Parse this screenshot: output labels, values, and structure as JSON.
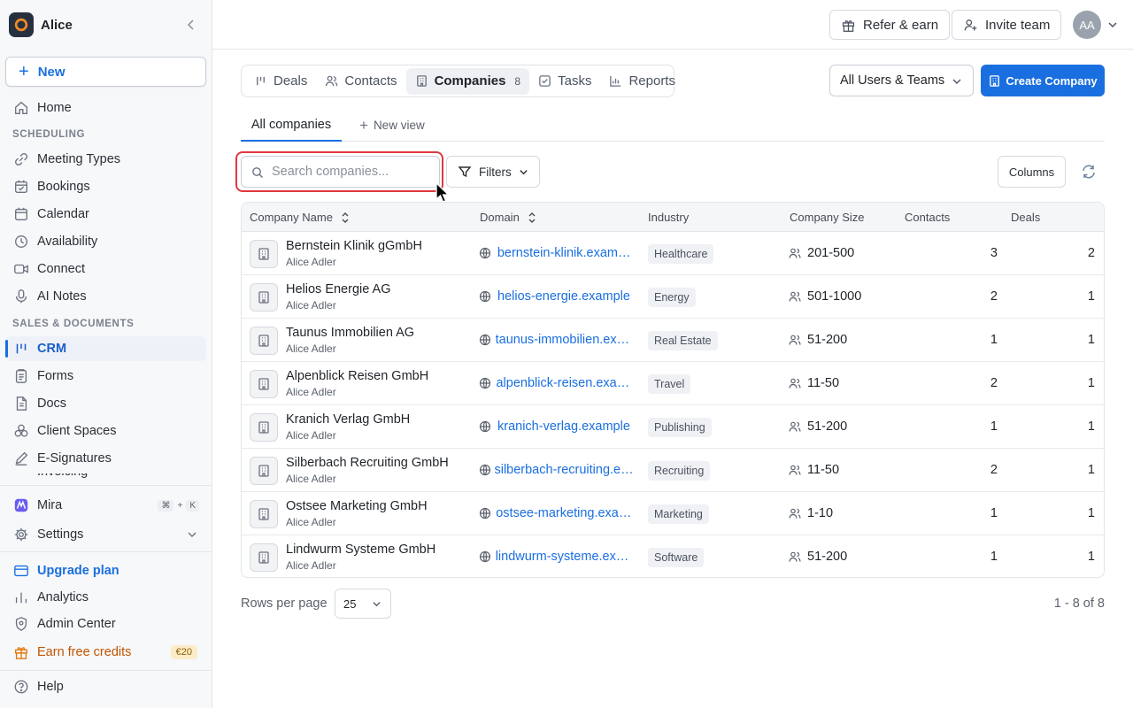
{
  "workspace": {
    "name": "Alice"
  },
  "sidebar": {
    "new_label": "New",
    "home": "Home",
    "section_scheduling": "SCHEDULING",
    "scheduling_items": [
      {
        "label": "Meeting Types",
        "icon": "link-icon"
      },
      {
        "label": "Bookings",
        "icon": "calendar-check-icon"
      },
      {
        "label": "Calendar",
        "icon": "calendar-icon"
      },
      {
        "label": "Availability",
        "icon": "clock-icon"
      },
      {
        "label": "Connect",
        "icon": "video-icon"
      },
      {
        "label": "AI Notes",
        "icon": "microphone-icon"
      }
    ],
    "section_sales": "SALES & DOCUMENTS",
    "sales_items": [
      {
        "label": "CRM",
        "icon": "crm-icon",
        "active": true
      },
      {
        "label": "Forms",
        "icon": "clipboard-icon"
      },
      {
        "label": "Docs",
        "icon": "document-icon"
      },
      {
        "label": "Client Spaces",
        "icon": "spaces-icon"
      },
      {
        "label": "E-Signatures",
        "icon": "pen-icon"
      },
      {
        "label": "Invoicing",
        "icon": "invoice-icon"
      }
    ],
    "mira": "Mira",
    "mira_shortcut": [
      "⌘",
      "+",
      "K"
    ],
    "settings": "Settings",
    "upgrade": "Upgrade plan",
    "analytics": "Analytics",
    "admin": "Admin Center",
    "earn": "Earn free credits",
    "earn_badge": "€20",
    "help": "Help"
  },
  "topbar": {
    "refer": "Refer & earn",
    "invite": "Invite team",
    "avatar_initials": "AA"
  },
  "crm_tabs": [
    {
      "label": "Deals",
      "icon": "deals-icon"
    },
    {
      "label": "Contacts",
      "icon": "contacts-icon"
    },
    {
      "label": "Companies",
      "icon": "building-icon",
      "count": "8",
      "selected": true
    },
    {
      "label": "Tasks",
      "icon": "task-icon"
    },
    {
      "label": "Reports",
      "icon": "chart-icon"
    }
  ],
  "users_filter": "All Users & Teams",
  "create_company": "Create Company",
  "views": {
    "current": "All companies",
    "new_view": "New view"
  },
  "search": {
    "placeholder": "Search companies..."
  },
  "filters_label": "Filters",
  "columns_label": "Columns",
  "table": {
    "headers": {
      "name": "Company Name",
      "domain": "Domain",
      "industry": "Industry",
      "size": "Company Size",
      "contacts": "Contacts",
      "deals": "Deals"
    },
    "rows": [
      {
        "name": "Bernstein Klinik gGmbH",
        "owner": "Alice Adler",
        "domain": "bernstein-klinik.example",
        "industry": "Healthcare",
        "size": "201-500",
        "contacts": "3",
        "deals": "2"
      },
      {
        "name": "Helios Energie AG",
        "owner": "Alice Adler",
        "domain": "helios-energie.example",
        "industry": "Energy",
        "size": "501-1000",
        "contacts": "2",
        "deals": "1"
      },
      {
        "name": "Taunus Immobilien AG",
        "owner": "Alice Adler",
        "domain": "taunus-immobilien.example",
        "industry": "Real Estate",
        "size": "51-200",
        "contacts": "1",
        "deals": "1"
      },
      {
        "name": "Alpenblick Reisen GmbH",
        "owner": "Alice Adler",
        "domain": "alpenblick-reisen.example",
        "industry": "Travel",
        "size": "11-50",
        "contacts": "2",
        "deals": "1"
      },
      {
        "name": "Kranich Verlag GmbH",
        "owner": "Alice Adler",
        "domain": "kranich-verlag.example",
        "industry": "Publishing",
        "size": "51-200",
        "contacts": "1",
        "deals": "1"
      },
      {
        "name": "Silberbach Recruiting GmbH",
        "owner": "Alice Adler",
        "domain": "silberbach-recruiting.example",
        "industry": "Recruiting",
        "size": "11-50",
        "contacts": "2",
        "deals": "1"
      },
      {
        "name": "Ostsee Marketing GmbH",
        "owner": "Alice Adler",
        "domain": "ostsee-marketing.example",
        "industry": "Marketing",
        "size": "1-10",
        "contacts": "1",
        "deals": "1"
      },
      {
        "name": "Lindwurm Systeme GmbH",
        "owner": "Alice Adler",
        "domain": "lindwurm-systeme.example",
        "industry": "Software",
        "size": "51-200",
        "contacts": "1",
        "deals": "1"
      }
    ]
  },
  "pagination": {
    "rows_label": "Rows per page",
    "rows_value": "25",
    "range": "1 - 8 of 8"
  },
  "colors": {
    "accent": "#1a6fe0",
    "highlight": "#e0383e"
  }
}
